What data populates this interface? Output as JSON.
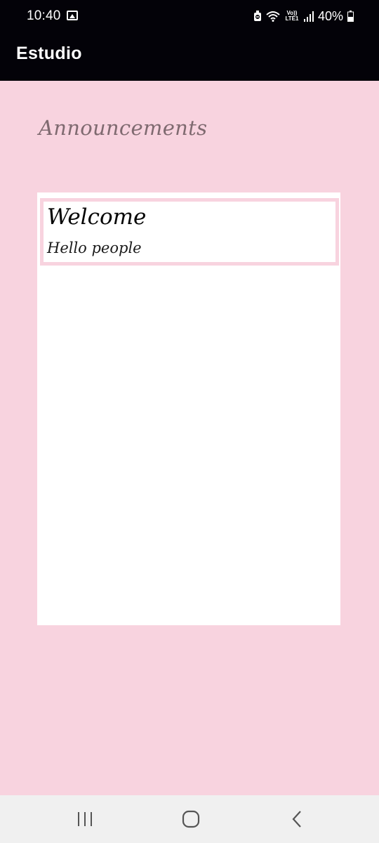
{
  "status_bar": {
    "time": "10:40",
    "battery_percent": "40%",
    "network_label_top": "Vo))",
    "network_label_bottom": "LTE1",
    "icons": [
      "gallery-icon",
      "do-not-disturb-icon",
      "wifi-icon",
      "signal-icon",
      "battery-icon"
    ]
  },
  "app_bar": {
    "title": "Estudio"
  },
  "main": {
    "section_title": "Announcements",
    "announcements": [
      {
        "title": "Welcome",
        "body": "Hello people"
      }
    ]
  },
  "nav_bar": {
    "icons": [
      "recents-icon",
      "home-icon",
      "back-icon"
    ]
  },
  "colors": {
    "background": "#f8d3df",
    "app_bar": "#030208",
    "section_title": "#7f6a70",
    "panel": "#ffffff",
    "nav_bar": "#f0f0f0"
  }
}
